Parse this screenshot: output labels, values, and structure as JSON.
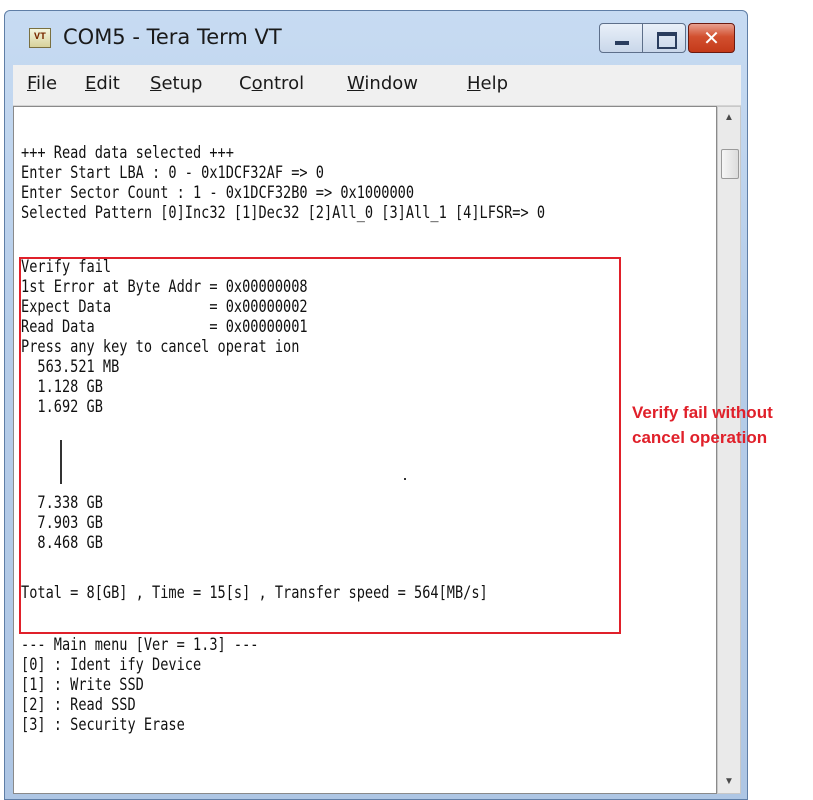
{
  "window": {
    "title": "COM5 - Tera Term VT",
    "app_icon_label": "VT"
  },
  "menu": [
    {
      "key": "F",
      "rest": "ile"
    },
    {
      "key": "E",
      "rest": "dit"
    },
    {
      "key": "S",
      "rest": "etup"
    },
    {
      "key": "o",
      "prefix": "C",
      "rest": "ntrol"
    },
    {
      "key": "W",
      "rest": "indow"
    },
    {
      "key": "H",
      "rest": "elp"
    }
  ],
  "terminal": {
    "lines": [
      "+++ Read data selected +++",
      "Enter Start LBA : 0 - 0x1DCF32AF => 0",
      "Enter Sector Count : 1 - 0x1DCF32B0 => 0x1000000",
      "Selected Pattern [0]Inc32 [1]Dec32 [2]All_0 [3]All_1 [4]LFSR=> 0",
      "Verify fail",
      "1st Error at Byte Addr = 0x00000008",
      "Expect Data            = 0x00000002",
      "Read Data              = 0x00000001",
      "Press any key to cancel operat ion",
      "  563.521 MB",
      "  1.128 GB",
      "  1.692 GB",
      "  7.338 GB",
      "  7.903 GB",
      "  8.468 GB",
      "Total = 8[GB] , Time = 15[s] , Transfer speed = 564[MB/s]",
      "--- Main menu [Ver = 1.3] ---",
      "[0] : Ident ify Device",
      "[1] : Write SSD",
      "[2] : Read SSD",
      "[3] : Security Erase"
    ]
  },
  "annotation": {
    "line1": "Verify fail without",
    "line2": "cancel operation",
    "color": "#e0202a"
  }
}
